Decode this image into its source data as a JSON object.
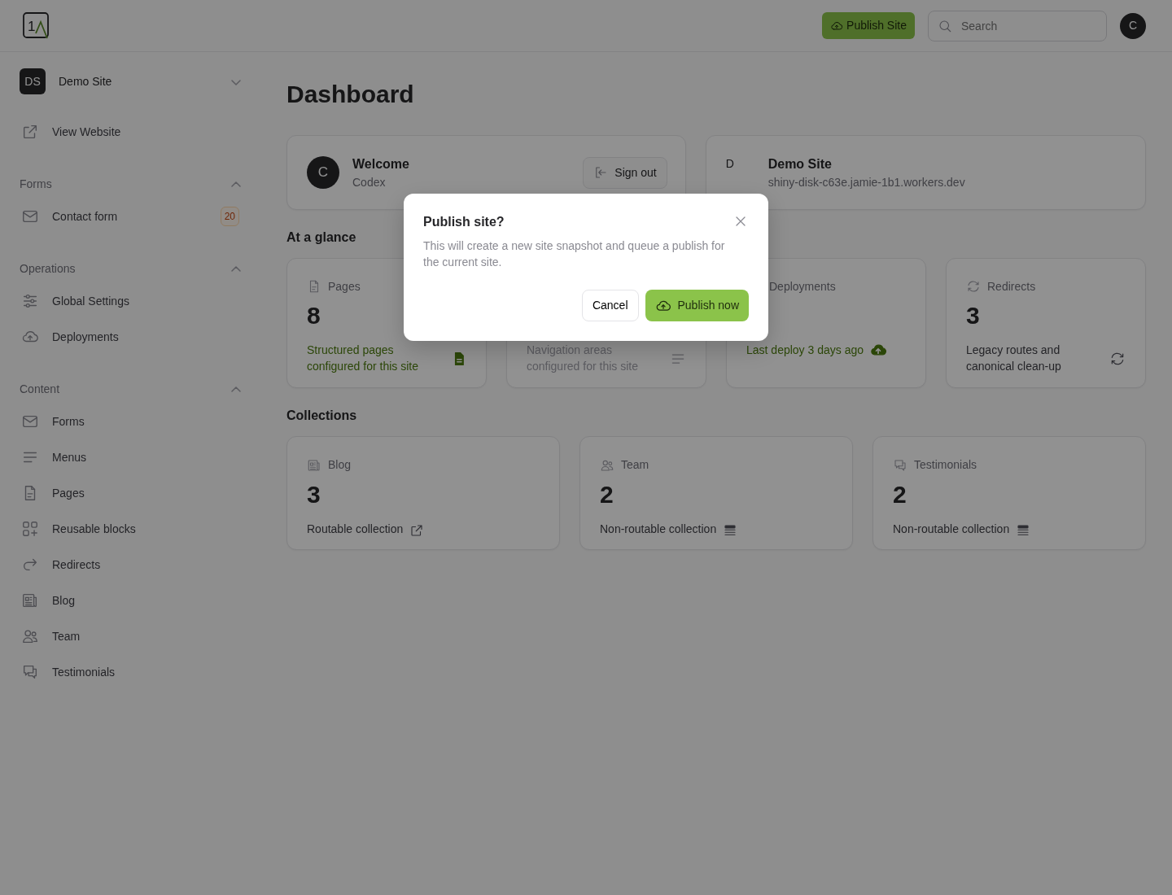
{
  "topbar": {
    "logo": "1",
    "publish_button": "Publish Site",
    "search": {
      "placeholder": "Search"
    },
    "avatar": "C"
  },
  "sidebar": {
    "site": {
      "initials": "DS",
      "name": "Demo Site"
    },
    "view_website": "View Website",
    "sections": [
      {
        "title": "Forms",
        "expanded": true,
        "items": [
          {
            "label": "Contact form",
            "badge": "20"
          }
        ]
      },
      {
        "title": "Operations",
        "expanded": true,
        "items": [
          {
            "label": "Global Settings"
          },
          {
            "label": "Deployments"
          }
        ]
      },
      {
        "title": "Content",
        "expanded": true,
        "items": [
          {
            "label": "Forms"
          },
          {
            "label": "Menus"
          },
          {
            "label": "Pages"
          },
          {
            "label": "Reusable blocks"
          },
          {
            "label": "Redirects"
          },
          {
            "label": "Blog"
          },
          {
            "label": "Team"
          },
          {
            "label": "Testimonials"
          }
        ]
      }
    ]
  },
  "main": {
    "title": "Dashboard",
    "welcome": {
      "avatar": "C",
      "title": "Welcome",
      "subtitle": "Codex",
      "button": "Sign out"
    },
    "site": {
      "initial": "D",
      "name": "Demo Site",
      "url": "shiny-disk-c63e.jamie-1b1.workers.dev"
    },
    "glance_title": "At a glance",
    "stats": [
      {
        "label": "Pages",
        "value": "8",
        "description": "Structured pages configured for this site",
        "kind": "success"
      },
      {
        "description": "Navigation areas configured for this site",
        "kind": "muted"
      },
      {
        "label": "Deployments",
        "description": "Last deploy 3 days ago",
        "kind": "success"
      },
      {
        "label": "Redirects",
        "value": "3",
        "description": "Legacy routes and canonical clean-up",
        "kind": "plain"
      }
    ],
    "collections_title": "Collections",
    "collections": [
      {
        "label": "Blog",
        "value": "3",
        "description": "Routable collection",
        "routable": true
      },
      {
        "label": "Team",
        "value": "2",
        "description": "Non-routable collection",
        "routable": false
      },
      {
        "label": "Testimonials",
        "value": "2",
        "description": "Non-routable collection",
        "routable": false
      }
    ]
  },
  "modal": {
    "title": "Publish site?",
    "message": "This will create a new site snapshot and queue a publish for the current site.",
    "cancel": "Cancel",
    "confirm": "Publish now"
  }
}
